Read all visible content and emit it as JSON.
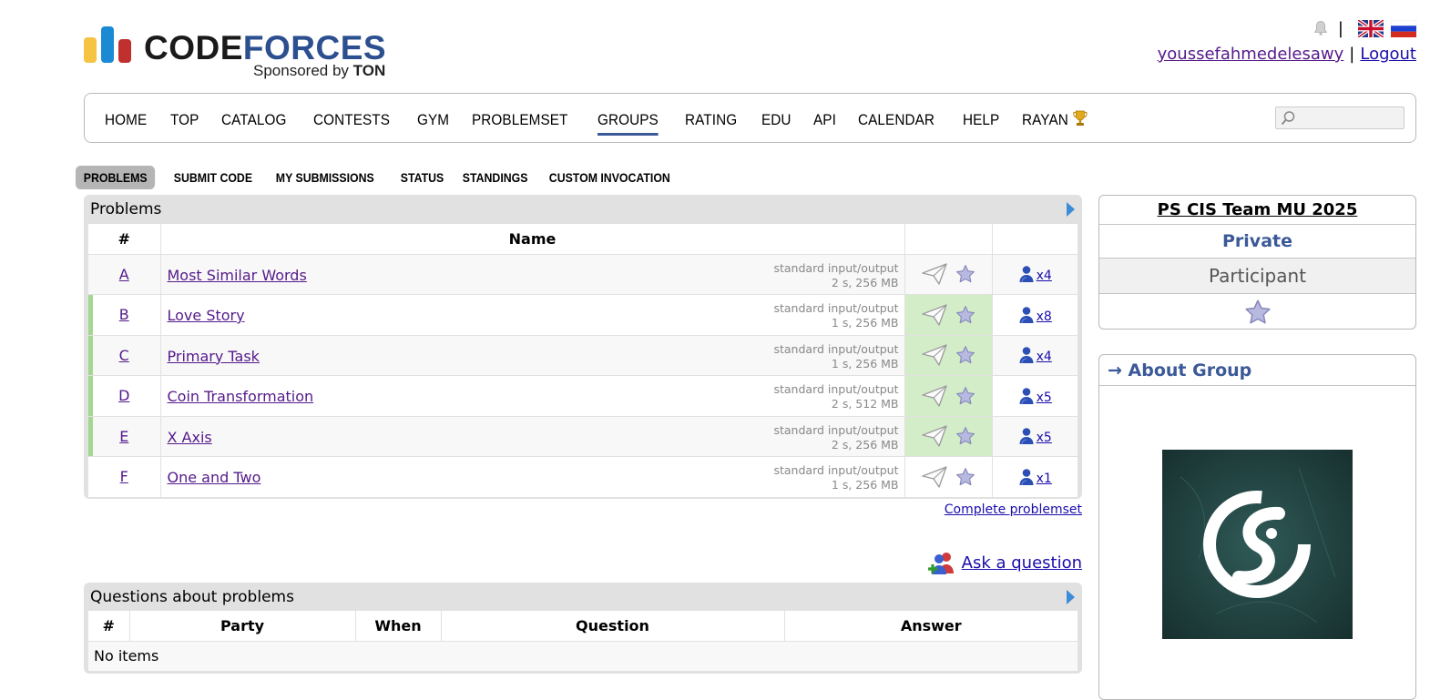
{
  "header": {
    "logo_code": "CODE",
    "logo_forces": "FORCES",
    "sponsor_prefix": "Sponsored by ",
    "sponsor_name": "TON",
    "lang_separator": "|",
    "username": "youssefahmedelesawy",
    "user_separator": "|",
    "logout": "Logout"
  },
  "nav": {
    "items": [
      "HOME",
      "TOP",
      "CATALOG",
      "CONTESTS",
      "GYM",
      "PROBLEMSET",
      "GROUPS",
      "RATING",
      "EDU",
      "API",
      "CALENDAR",
      "HELP",
      "RAYAN"
    ],
    "active": "GROUPS"
  },
  "submenu": {
    "items": [
      "PROBLEMS",
      "SUBMIT CODE",
      "MY SUBMISSIONS",
      "STATUS",
      "STANDINGS",
      "CUSTOM INVOCATION"
    ],
    "active": "PROBLEMS"
  },
  "problems": {
    "title": "Problems",
    "headers": {
      "index": "#",
      "name": "Name"
    },
    "rows": [
      {
        "letter": "A",
        "name": "Most Similar Words",
        "io": "standard input/output",
        "limits": "2 s, 256 MB",
        "solvers": "x4",
        "accepted": false
      },
      {
        "letter": "B",
        "name": "Love Story",
        "io": "standard input/output",
        "limits": "1 s, 256 MB",
        "solvers": "x8",
        "accepted": true
      },
      {
        "letter": "C",
        "name": "Primary Task",
        "io": "standard input/output",
        "limits": "1 s, 256 MB",
        "solvers": "x4",
        "accepted": true
      },
      {
        "letter": "D",
        "name": "Coin Transformation",
        "io": "standard input/output",
        "limits": "2 s, 512 MB",
        "solvers": "x5",
        "accepted": true
      },
      {
        "letter": "E",
        "name": "X Axis",
        "io": "standard input/output",
        "limits": "2 s, 256 MB",
        "solvers": "x5",
        "accepted": true
      },
      {
        "letter": "F",
        "name": "One and Two",
        "io": "standard input/output",
        "limits": "1 s, 256 MB",
        "solvers": "x1",
        "accepted": false
      }
    ],
    "complete_link": "Complete problemset"
  },
  "ask": {
    "label": "Ask a question"
  },
  "questions": {
    "title": "Questions about problems",
    "headers": [
      "#",
      "Party",
      "When",
      "Question",
      "Answer"
    ],
    "empty": "No items"
  },
  "sidebar": {
    "group_name": "PS CIS Team MU 2025",
    "visibility": "Private",
    "role": "Participant",
    "about_arrow": "→",
    "about_title": "About Group"
  },
  "colors": {
    "accent": "#3b5998",
    "accepted": "#d4edc9",
    "accepted_bar": "#a4d78f",
    "link": "#551a8b"
  }
}
